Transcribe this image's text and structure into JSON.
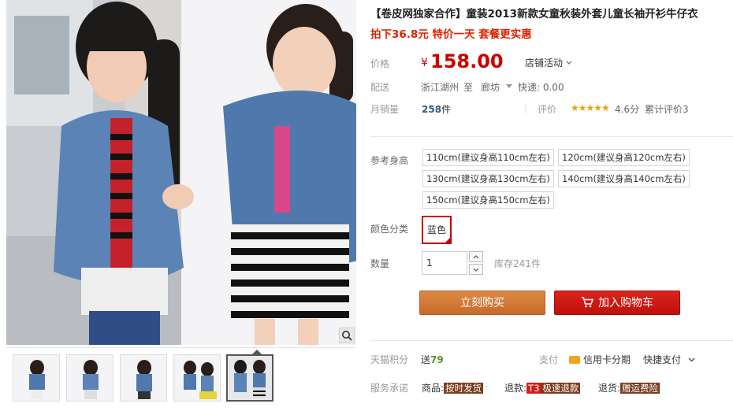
{
  "product": {
    "title": "【卷皮网独家合作】童装2013新款女童秋装外套儿童长袖开衫牛仔衣",
    "subtitle": "拍下36.8元 特价一天 套餐更实惠"
  },
  "price": {
    "label": "价格",
    "currency": "¥",
    "value": "158.00",
    "promo_label": "店铺活动"
  },
  "shipping": {
    "label": "配送",
    "origin": "浙江湖州",
    "to": "至",
    "destination": "廊坊",
    "fee": "快递: 0.00"
  },
  "sales": {
    "label": "月销量",
    "count": "258",
    "unit": "件",
    "rating_label": "评价",
    "stars": "★★★★★",
    "rating": "4.6分",
    "reviews": "累计评价3"
  },
  "sku": {
    "size_label": "参考身高",
    "sizes": [
      "110cm(建议身高110cm左右)",
      "120cm(建议身高120cm左右)",
      "130cm(建议身高130cm左右)",
      "140cm(建议身高140cm左右)",
      "150cm(建议身高150cm左右)"
    ],
    "color_label": "颜色分类",
    "color_value": "蓝色",
    "qty_label": "数量",
    "qty_value": "1",
    "stock": "库存241件"
  },
  "buttons": {
    "buy_now": "立刻购买",
    "add_to_cart": "加入购物车"
  },
  "points": {
    "label": "天猫积分",
    "send": "送",
    "value": "79",
    "pay_label": "支付",
    "credit": "信用卡分期",
    "quick_pay": "快捷支付"
  },
  "service": {
    "label": "服务承诺",
    "item1_prefix": "商品:",
    "item1_tag": "按时发货",
    "item2_prefix": "退款:",
    "item2_badge": "T3",
    "item2_tag": "极速退款",
    "item3_prefix": "退货:",
    "item3_tag": "赠运费险"
  },
  "colors": {
    "price_red": "#cc0000",
    "buy_orange": "#d27a3a",
    "cart_red": "#d41e18"
  }
}
